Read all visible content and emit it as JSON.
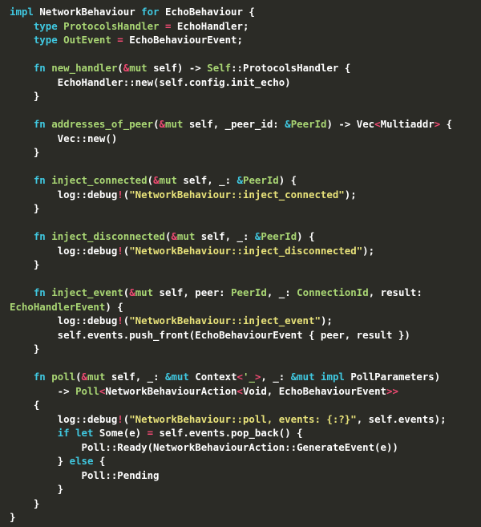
{
  "editor": {
    "background": "#2b2b26",
    "language": "rust",
    "colors": {
      "plain": "#e8e6d8",
      "keyword": "#40c8e0",
      "type": "#a9d674",
      "function": "#a9d674",
      "punctuation": "#ef4a72",
      "string": "#e8e27a",
      "white": "#ffffff"
    }
  },
  "code": {
    "lines": [
      {
        "id": "line-1",
        "tokens": [
          {
            "t": "impl ",
            "c": "kw"
          },
          {
            "t": "NetworkBehaviour ",
            "c": "white"
          },
          {
            "t": "for ",
            "c": "kw"
          },
          {
            "t": "EchoBehaviour {",
            "c": "white"
          }
        ]
      },
      {
        "id": "line-2",
        "tokens": [
          {
            "t": "    ",
            "c": "plain"
          },
          {
            "t": "type ",
            "c": "kw"
          },
          {
            "t": "ProtocolsHandler ",
            "c": "type"
          },
          {
            "t": "=",
            "c": "punct"
          },
          {
            "t": " EchoHandler;",
            "c": "white"
          }
        ]
      },
      {
        "id": "line-3",
        "tokens": [
          {
            "t": "    ",
            "c": "plain"
          },
          {
            "t": "type ",
            "c": "kw"
          },
          {
            "t": "OutEvent ",
            "c": "type"
          },
          {
            "t": "=",
            "c": "punct"
          },
          {
            "t": " EchoBehaviourEvent;",
            "c": "white"
          }
        ]
      },
      {
        "id": "line-4",
        "tokens": []
      },
      {
        "id": "line-5",
        "tokens": [
          {
            "t": "    ",
            "c": "plain"
          },
          {
            "t": "fn ",
            "c": "kw"
          },
          {
            "t": "new_handler",
            "c": "fn"
          },
          {
            "t": "(",
            "c": "white"
          },
          {
            "t": "&",
            "c": "punct"
          },
          {
            "t": "mut",
            "c": "type"
          },
          {
            "t": " self) -> ",
            "c": "white"
          },
          {
            "t": "Self",
            "c": "type"
          },
          {
            "t": "::ProtocolsHandler {",
            "c": "white"
          }
        ]
      },
      {
        "id": "line-6",
        "tokens": [
          {
            "t": "        EchoHandler::new(self.config.init_echo)",
            "c": "white"
          }
        ]
      },
      {
        "id": "line-7",
        "tokens": [
          {
            "t": "    }",
            "c": "white"
          }
        ]
      },
      {
        "id": "line-8",
        "tokens": []
      },
      {
        "id": "line-9",
        "tokens": [
          {
            "t": "    ",
            "c": "plain"
          },
          {
            "t": "fn ",
            "c": "kw"
          },
          {
            "t": "addresses_of_peer",
            "c": "fn"
          },
          {
            "t": "(",
            "c": "white"
          },
          {
            "t": "&",
            "c": "punct"
          },
          {
            "t": "mut",
            "c": "type"
          },
          {
            "t": " self, _peer_id: ",
            "c": "white"
          },
          {
            "t": "&",
            "c": "kw"
          },
          {
            "t": "PeerId",
            "c": "type"
          },
          {
            "t": ") -> Vec",
            "c": "white"
          },
          {
            "t": "<",
            "c": "punct"
          },
          {
            "t": "Multiaddr",
            "c": "white"
          },
          {
            "t": ">",
            "c": "punct"
          },
          {
            "t": " {",
            "c": "white"
          }
        ]
      },
      {
        "id": "line-10",
        "tokens": [
          {
            "t": "        Vec::new()",
            "c": "white"
          }
        ]
      },
      {
        "id": "line-11",
        "tokens": [
          {
            "t": "    }",
            "c": "white"
          }
        ]
      },
      {
        "id": "line-12",
        "tokens": []
      },
      {
        "id": "line-13",
        "tokens": [
          {
            "t": "    ",
            "c": "plain"
          },
          {
            "t": "fn ",
            "c": "kw"
          },
          {
            "t": "inject_connected",
            "c": "fn"
          },
          {
            "t": "(",
            "c": "white"
          },
          {
            "t": "&",
            "c": "punct"
          },
          {
            "t": "mut",
            "c": "type"
          },
          {
            "t": " self, _: ",
            "c": "white"
          },
          {
            "t": "&",
            "c": "kw"
          },
          {
            "t": "PeerId",
            "c": "type"
          },
          {
            "t": ") {",
            "c": "white"
          }
        ]
      },
      {
        "id": "line-14",
        "tokens": [
          {
            "t": "        log::debug",
            "c": "white"
          },
          {
            "t": "!",
            "c": "punct"
          },
          {
            "t": "(",
            "c": "white"
          },
          {
            "t": "\"NetworkBehaviour::inject_connected\"",
            "c": "str"
          },
          {
            "t": ");",
            "c": "white"
          }
        ]
      },
      {
        "id": "line-15",
        "tokens": [
          {
            "t": "    }",
            "c": "white"
          }
        ]
      },
      {
        "id": "line-16",
        "tokens": []
      },
      {
        "id": "line-17",
        "tokens": [
          {
            "t": "    ",
            "c": "plain"
          },
          {
            "t": "fn ",
            "c": "kw"
          },
          {
            "t": "inject_disconnected",
            "c": "fn"
          },
          {
            "t": "(",
            "c": "white"
          },
          {
            "t": "&",
            "c": "punct"
          },
          {
            "t": "mut",
            "c": "type"
          },
          {
            "t": " self, _: ",
            "c": "white"
          },
          {
            "t": "&",
            "c": "kw"
          },
          {
            "t": "PeerId",
            "c": "type"
          },
          {
            "t": ") {",
            "c": "white"
          }
        ]
      },
      {
        "id": "line-18",
        "tokens": [
          {
            "t": "        log::debug",
            "c": "white"
          },
          {
            "t": "!",
            "c": "punct"
          },
          {
            "t": "(",
            "c": "white"
          },
          {
            "t": "\"NetworkBehaviour::inject_disconnected\"",
            "c": "str"
          },
          {
            "t": ");",
            "c": "white"
          }
        ]
      },
      {
        "id": "line-19",
        "tokens": [
          {
            "t": "    }",
            "c": "white"
          }
        ]
      },
      {
        "id": "line-20",
        "tokens": []
      },
      {
        "id": "line-21",
        "tokens": [
          {
            "t": "    ",
            "c": "plain"
          },
          {
            "t": "fn ",
            "c": "kw"
          },
          {
            "t": "inject_event",
            "c": "fn"
          },
          {
            "t": "(",
            "c": "white"
          },
          {
            "t": "&",
            "c": "punct"
          },
          {
            "t": "mut",
            "c": "type"
          },
          {
            "t": " self, peer: ",
            "c": "white"
          },
          {
            "t": "PeerId",
            "c": "type"
          },
          {
            "t": ", _: ",
            "c": "white"
          },
          {
            "t": "ConnectionId",
            "c": "type"
          },
          {
            "t": ", result:",
            "c": "white"
          }
        ]
      },
      {
        "id": "line-22",
        "tokens": [
          {
            "t": "EchoHandlerEvent",
            "c": "type"
          },
          {
            "t": ") {",
            "c": "white"
          }
        ]
      },
      {
        "id": "line-23",
        "tokens": [
          {
            "t": "        log::debug",
            "c": "white"
          },
          {
            "t": "!",
            "c": "punct"
          },
          {
            "t": "(",
            "c": "white"
          },
          {
            "t": "\"NetworkBehaviour::inject_event\"",
            "c": "str"
          },
          {
            "t": ");",
            "c": "white"
          }
        ]
      },
      {
        "id": "line-24",
        "tokens": [
          {
            "t": "        self.events.push_front(EchoBehaviourEvent { peer, result })",
            "c": "white"
          }
        ]
      },
      {
        "id": "line-25",
        "tokens": [
          {
            "t": "    }",
            "c": "white"
          }
        ]
      },
      {
        "id": "line-26",
        "tokens": []
      },
      {
        "id": "line-27",
        "tokens": [
          {
            "t": "    ",
            "c": "plain"
          },
          {
            "t": "fn ",
            "c": "kw"
          },
          {
            "t": "poll",
            "c": "fn"
          },
          {
            "t": "(",
            "c": "white"
          },
          {
            "t": "&",
            "c": "punct"
          },
          {
            "t": "mut",
            "c": "type"
          },
          {
            "t": " self, _: ",
            "c": "white"
          },
          {
            "t": "&mut",
            "c": "kw"
          },
          {
            "t": " Context",
            "c": "white"
          },
          {
            "t": "<",
            "c": "punct"
          },
          {
            "t": "'_",
            "c": "type"
          },
          {
            "t": ">",
            "c": "punct"
          },
          {
            "t": ", _: ",
            "c": "white"
          },
          {
            "t": "&mut",
            "c": "kw"
          },
          {
            "t": " ",
            "c": "white"
          },
          {
            "t": "impl",
            "c": "kw"
          },
          {
            "t": " PollParameters)",
            "c": "white"
          }
        ]
      },
      {
        "id": "line-28",
        "tokens": [
          {
            "t": "        -> ",
            "c": "white"
          },
          {
            "t": "Poll",
            "c": "type"
          },
          {
            "t": "<",
            "c": "punct"
          },
          {
            "t": "NetworkBehaviourAction",
            "c": "white"
          },
          {
            "t": "<",
            "c": "punct"
          },
          {
            "t": "Void, EchoBehaviourEvent",
            "c": "white"
          },
          {
            "t": ">>",
            "c": "punct"
          }
        ]
      },
      {
        "id": "line-29",
        "tokens": [
          {
            "t": "    {",
            "c": "white"
          }
        ]
      },
      {
        "id": "line-30",
        "tokens": [
          {
            "t": "        log::debug",
            "c": "white"
          },
          {
            "t": "!",
            "c": "punct"
          },
          {
            "t": "(",
            "c": "white"
          },
          {
            "t": "\"NetworkBehaviour::poll, events: {:?}\"",
            "c": "str"
          },
          {
            "t": ", self.events);",
            "c": "white"
          }
        ]
      },
      {
        "id": "line-31",
        "tokens": [
          {
            "t": "        ",
            "c": "plain"
          },
          {
            "t": "if ",
            "c": "kw"
          },
          {
            "t": "let ",
            "c": "kw"
          },
          {
            "t": "Some(e) ",
            "c": "white"
          },
          {
            "t": "=",
            "c": "punct"
          },
          {
            "t": " self.events.pop_back() {",
            "c": "white"
          }
        ]
      },
      {
        "id": "line-32",
        "tokens": [
          {
            "t": "            Poll::Ready(NetworkBehaviourAction::GenerateEvent(e))",
            "c": "white"
          }
        ]
      },
      {
        "id": "line-33",
        "tokens": [
          {
            "t": "        } ",
            "c": "white"
          },
          {
            "t": "else",
            "c": "kw"
          },
          {
            "t": " {",
            "c": "white"
          }
        ]
      },
      {
        "id": "line-34",
        "tokens": [
          {
            "t": "            Poll::Pending",
            "c": "white"
          }
        ]
      },
      {
        "id": "line-35",
        "tokens": [
          {
            "t": "        }",
            "c": "white"
          }
        ]
      },
      {
        "id": "line-36",
        "tokens": [
          {
            "t": "    }",
            "c": "white"
          }
        ]
      },
      {
        "id": "line-37",
        "tokens": [
          {
            "t": "}",
            "c": "white"
          }
        ]
      }
    ]
  }
}
